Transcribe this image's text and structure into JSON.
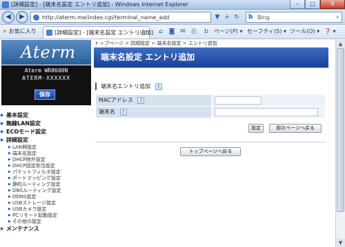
{
  "window": {
    "title": "[詳細設定] - [端末名設定 エントリ追加] - Windows Internet Explorer",
    "controls": {
      "minimize": "–",
      "maximize": "□",
      "close": "X"
    }
  },
  "navbar": {
    "back": "◀",
    "forward": "▶",
    "url": "http://aterm.me/index.cgi/terminal_name_add",
    "dropdown": "▼",
    "refresh": "↻",
    "compat": "+",
    "stop": "✕",
    "search_engine_icon": "b",
    "search_placeholder": "Bing",
    "search_icon": "⌕"
  },
  "commandbar": {
    "favorites_label": "お気に入り",
    "tab_title": "[詳細設定] - [端末名設定 エントリ追加]",
    "page_menu": "ページ(P) ▾",
    "safety_menu": "セーフティ(S) ▾",
    "tools_menu": "ツール(O) ▾",
    "help_menu": "❓ ▾"
  },
  "sidebar": {
    "logo": "Aterm",
    "model_name": "Aterm WR8600N",
    "model_code": "ATERM-XXXXXX",
    "save_button": "保存",
    "menu": [
      {
        "label": "基本設定",
        "items": []
      },
      {
        "label": "無線LAN設定",
        "items": []
      },
      {
        "label": "ECOモード設定",
        "items": []
      },
      {
        "label": "詳細設定",
        "items": [
          "LAN側設定",
          "端末名設定",
          "DHCP除外設定",
          "DHCP固定割当設定",
          "パケットフィルタ設定",
          "ポートマッピング設定",
          "静的ルーティング設定",
          "DNSルーティング設定",
          "DDNS設定",
          "USBストレージ設定",
          "USBカメラ設定",
          "PCリモート起動設定",
          "その他の設定"
        ]
      },
      {
        "label": "メンテナンス",
        "items": []
      }
    ]
  },
  "main": {
    "breadcrumb": "トップページ > 詳細設定 > 端末名設定 > エントリ追加",
    "page_title": "端末名設定 エントリ追加",
    "section_title": "端末名エントリ追加",
    "help": "?",
    "fields": [
      {
        "label": "MACアドレス",
        "value": ""
      },
      {
        "label": "端末名",
        "value": ""
      }
    ],
    "set_button": "設定",
    "back_button": "前のページへ戻る",
    "top_button": "トップページへ戻る"
  }
}
